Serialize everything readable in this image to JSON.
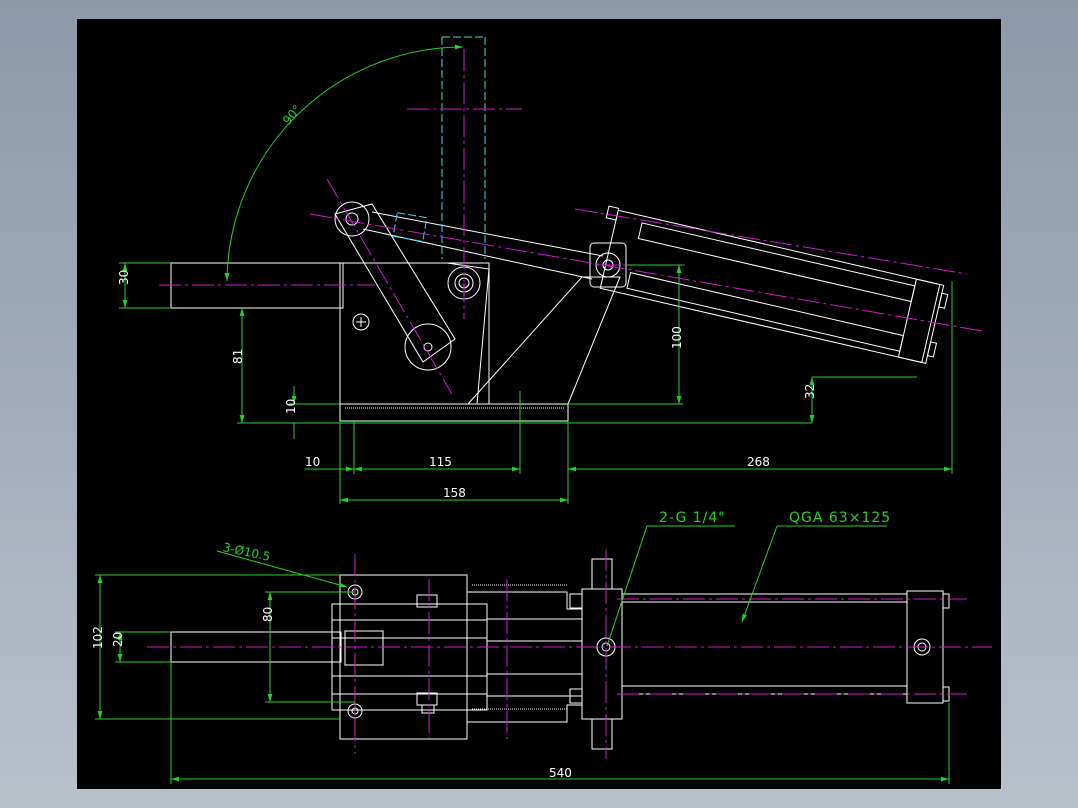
{
  "drawing": {
    "background": "#000000",
    "frame_color": "#8d99a8",
    "colors": {
      "outline": "#ffffff",
      "dimension": "#22d422",
      "centerline": "#d01ad0",
      "hidden": "#3fd7e6"
    }
  },
  "dims_elevation": {
    "angle": "90°",
    "d30": "30",
    "d81": "81",
    "d10v": "10",
    "d100": "100",
    "d32": "32",
    "d10h": "10",
    "d115": "115",
    "d158": "158",
    "d268": "268"
  },
  "dims_plan": {
    "holes": "3-Ø10.5",
    "d20": "20",
    "d80": "80",
    "d102": "102",
    "d540": "540"
  },
  "labels": {
    "port": "2-G 1/4\"",
    "cylinder": "QGA 63×125"
  }
}
